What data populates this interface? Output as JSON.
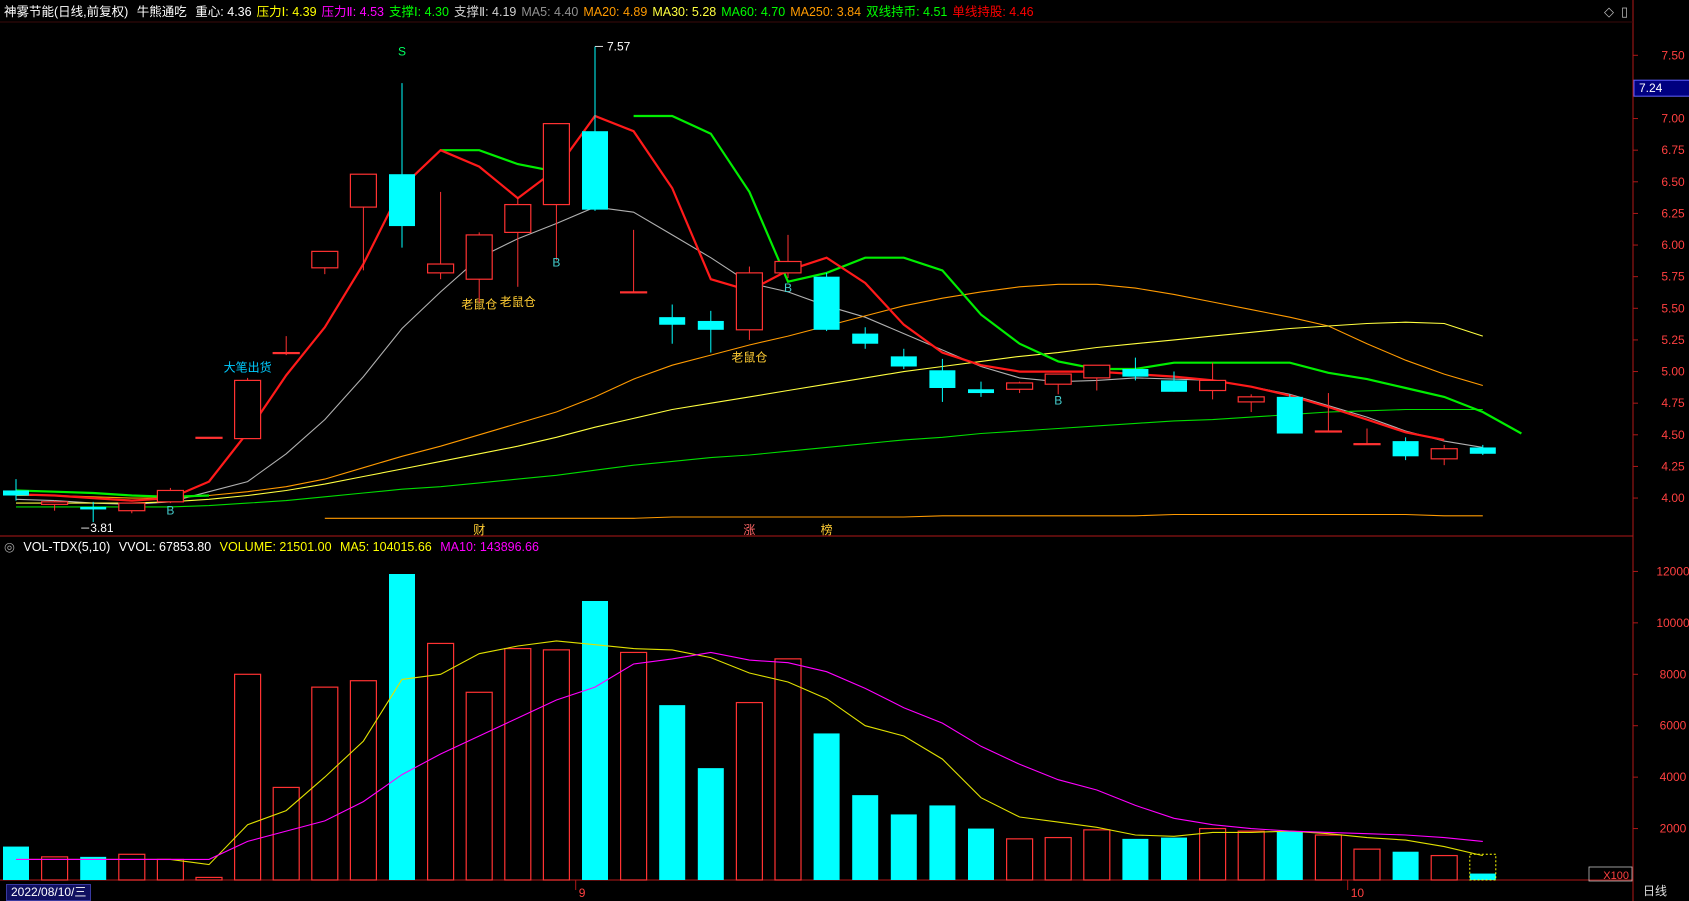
{
  "header": {
    "title": "神雾节能(日线,前复权)",
    "indicator": "牛熊通吃",
    "items": [
      {
        "label": "重心: 4.36",
        "color": "#ffffff"
      },
      {
        "label": "压力Ⅰ: 4.39",
        "color": "#ffff00"
      },
      {
        "label": "压力Ⅱ: 4.53",
        "color": "#ff00ff"
      },
      {
        "label": "支撑Ⅰ: 4.30",
        "color": "#00ff00"
      },
      {
        "label": "支撑Ⅱ: 4.19",
        "color": "#cfcfcf"
      },
      {
        "label": "MA5: 4.40",
        "color": "#909090"
      },
      {
        "label": "MA20: 4.89",
        "color": "#ff9a00"
      },
      {
        "label": "MA30: 5.28",
        "color": "#ffff40"
      },
      {
        "label": "MA60: 4.70",
        "color": "#00ff00"
      },
      {
        "label": "MA250: 3.84",
        "color": "#ff9a00"
      },
      {
        "label": "双线持币: 4.51",
        "color": "#00ff00"
      },
      {
        "label": "单线持股: 4.46",
        "color": "#ff0000"
      }
    ]
  },
  "volume_header": {
    "title": "VOL-TDX(5,10)",
    "vvol": "VVOL: 67853.80",
    "volume": "VOLUME: 21501.00",
    "ma5": "MA5: 104015.66",
    "ma10": "MA10: 143896.66"
  },
  "footer": {
    "date": "2022/08/10/三",
    "period": "日线",
    "unit": "X100"
  },
  "colors": {
    "up": "#ff3232",
    "down": "#00ffff",
    "bg": "#000000",
    "axis": "#b01818"
  },
  "chart_data": [
    {
      "type": "candlestick",
      "title": "神雾节能(日线,前复权)",
      "ylim": [
        3.7,
        7.7
      ],
      "y_ticks": [
        "4.00",
        "4.25",
        "4.50",
        "4.75",
        "5.00",
        "5.25",
        "5.50",
        "5.75",
        "6.00",
        "6.25",
        "6.50",
        "6.75",
        "7.00",
        "7.25",
        "7.50"
      ],
      "last_price": "7.24",
      "month_labels": [
        "9",
        "10"
      ],
      "bars": [
        {
          "o": 4.06,
          "h": 4.15,
          "l": 3.98,
          "c": 4.02
        },
        {
          "o": 3.95,
          "h": 3.98,
          "l": 3.9,
          "c": 3.97
        },
        {
          "o": 3.93,
          "h": 3.97,
          "l": 3.81,
          "c": 3.91
        },
        {
          "o": 3.9,
          "h": 3.95,
          "l": 3.88,
          "c": 3.96
        },
        {
          "o": 3.97,
          "h": 4.08,
          "l": 3.96,
          "c": 4.06
        },
        {
          "o": 4.48,
          "h": 4.48,
          "l": 4.48,
          "c": 4.48
        },
        {
          "o": 4.47,
          "h": 4.95,
          "l": 4.47,
          "c": 4.93
        },
        {
          "o": 5.15,
          "h": 5.28,
          "l": 5.13,
          "c": 5.15
        },
        {
          "o": 5.82,
          "h": 5.95,
          "l": 5.77,
          "c": 5.95
        },
        {
          "o": 6.3,
          "h": 6.56,
          "l": 5.8,
          "c": 6.56
        },
        {
          "o": 6.56,
          "h": 7.28,
          "l": 5.98,
          "c": 6.15
        },
        {
          "o": 5.78,
          "h": 6.42,
          "l": 5.73,
          "c": 5.85
        },
        {
          "o": 5.73,
          "h": 6.1,
          "l": 5.54,
          "c": 6.08
        },
        {
          "o": 6.1,
          "h": 6.38,
          "l": 5.67,
          "c": 6.32
        },
        {
          "o": 6.32,
          "h": 6.52,
          "l": 5.88,
          "c": 6.96
        },
        {
          "o": 6.9,
          "h": 7.57,
          "l": 6.27,
          "c": 6.28
        },
        {
          "o": 5.63,
          "h": 6.12,
          "l": 5.63,
          "c": 5.63
        },
        {
          "o": 5.43,
          "h": 5.53,
          "l": 5.22,
          "c": 5.37
        },
        {
          "o": 5.4,
          "h": 5.48,
          "l": 5.15,
          "c": 5.33
        },
        {
          "o": 5.33,
          "h": 5.83,
          "l": 5.25,
          "c": 5.78
        },
        {
          "o": 5.78,
          "h": 6.08,
          "l": 5.74,
          "c": 5.87
        },
        {
          "o": 5.75,
          "h": 5.78,
          "l": 5.32,
          "c": 5.33
        },
        {
          "o": 5.3,
          "h": 5.35,
          "l": 5.18,
          "c": 5.22
        },
        {
          "o": 5.12,
          "h": 5.18,
          "l": 5.02,
          "c": 5.04
        },
        {
          "o": 5.01,
          "h": 5.1,
          "l": 4.76,
          "c": 4.87
        },
        {
          "o": 4.86,
          "h": 4.92,
          "l": 4.8,
          "c": 4.83
        },
        {
          "o": 4.86,
          "h": 4.92,
          "l": 4.83,
          "c": 4.91
        },
        {
          "o": 4.9,
          "h": 4.98,
          "l": 4.82,
          "c": 4.98
        },
        {
          "o": 4.95,
          "h": 5.05,
          "l": 4.85,
          "c": 5.05
        },
        {
          "o": 5.02,
          "h": 5.11,
          "l": 4.93,
          "c": 4.96
        },
        {
          "o": 4.93,
          "h": 5.0,
          "l": 4.84,
          "c": 4.84
        },
        {
          "o": 4.85,
          "h": 5.07,
          "l": 4.78,
          "c": 4.93
        },
        {
          "o": 4.76,
          "h": 4.82,
          "l": 4.68,
          "c": 4.8
        },
        {
          "o": 4.8,
          "h": 4.82,
          "l": 4.51,
          "c": 4.51
        },
        {
          "o": 4.53,
          "h": 4.83,
          "l": 4.53,
          "c": 4.53
        },
        {
          "o": 4.43,
          "h": 4.55,
          "l": 4.43,
          "c": 4.43
        },
        {
          "o": 4.45,
          "h": 4.48,
          "l": 4.3,
          "c": 4.33
        },
        {
          "o": 4.31,
          "h": 4.42,
          "l": 4.26,
          "c": 4.39
        },
        {
          "o": 4.4,
          "h": 4.42,
          "l": 4.34,
          "c": 4.35
        }
      ],
      "series": [
        {
          "name": "MA5",
          "color": "#b0b0b0",
          "values": [
            3.99,
            3.98,
            3.96,
            3.95,
            3.97,
            4.05,
            4.13,
            4.35,
            4.62,
            4.96,
            5.34,
            5.63,
            5.9,
            6.05,
            6.17,
            6.3,
            6.26,
            6.08,
            5.9,
            5.7,
            5.63,
            5.52,
            5.43,
            5.3,
            5.17,
            5.04,
            4.95,
            4.92,
            4.93,
            4.95,
            4.94,
            4.93,
            4.88,
            4.82,
            4.73,
            4.64,
            4.53,
            4.45,
            4.4
          ]
        },
        {
          "name": "MA20",
          "color": "#ff9a00",
          "values": [
            4.02,
            4.02,
            4.01,
            4.0,
            4.0,
            4.02,
            4.05,
            4.09,
            4.15,
            4.24,
            4.33,
            4.41,
            4.5,
            4.59,
            4.68,
            4.8,
            4.94,
            5.05,
            5.13,
            5.21,
            5.28,
            5.36,
            5.44,
            5.52,
            5.58,
            5.63,
            5.67,
            5.69,
            5.69,
            5.66,
            5.61,
            5.55,
            5.49,
            5.43,
            5.36,
            5.22,
            5.09,
            4.98,
            4.89
          ]
        },
        {
          "name": "MA30",
          "color": "#ffff40",
          "values": [
            3.96,
            3.96,
            3.96,
            3.96,
            3.97,
            3.99,
            4.02,
            4.06,
            4.11,
            4.17,
            4.23,
            4.29,
            4.35,
            4.41,
            4.48,
            4.56,
            4.63,
            4.7,
            4.75,
            4.8,
            4.85,
            4.9,
            4.95,
            5.0,
            5.04,
            5.08,
            5.12,
            5.15,
            5.19,
            5.22,
            5.25,
            5.28,
            5.31,
            5.34,
            5.36,
            5.38,
            5.39,
            5.38,
            5.28
          ]
        },
        {
          "name": "MA60",
          "color": "#00dd00",
          "values": [
            3.93,
            3.93,
            3.93,
            3.93,
            3.93,
            3.94,
            3.96,
            3.98,
            4.01,
            4.04,
            4.07,
            4.09,
            4.12,
            4.15,
            4.18,
            4.22,
            4.26,
            4.29,
            4.32,
            4.34,
            4.37,
            4.4,
            4.43,
            4.46,
            4.48,
            4.51,
            4.53,
            4.55,
            4.57,
            4.59,
            4.61,
            4.62,
            4.64,
            4.66,
            4.68,
            4.69,
            4.7,
            4.7,
            4.7
          ]
        },
        {
          "name": "MA250",
          "color": "#ff9a00",
          "x_from": 8,
          "values": [
            3.84,
            3.84,
            3.84,
            3.84,
            3.84,
            3.84,
            3.84,
            3.84,
            3.84,
            3.85,
            3.85,
            3.85,
            3.85,
            3.85,
            3.85,
            3.85,
            3.86,
            3.86,
            3.86,
            3.86,
            3.86,
            3.86,
            3.87,
            3.87,
            3.87,
            3.87,
            3.87,
            3.87,
            3.87,
            3.86,
            3.86
          ]
        },
        {
          "name": "双线持币",
          "color": "#00ee00",
          "segments": [
            {
              "from": 0,
              "values": [
                4.06,
                4.05,
                4.04,
                4.02,
                4.01,
                4.02
              ]
            },
            {
              "from": 11,
              "values": [
                6.75,
                6.75,
                6.64,
                6.58
              ]
            },
            {
              "from": 16,
              "values": [
                7.02,
                7.02,
                6.88,
                6.42,
                5.71,
                5.78,
                5.9,
                5.9,
                5.8,
                5.45,
                5.22,
                5.08,
                5.02,
                5.02,
                5.07,
                5.07,
                5.07,
                5.07,
                4.99,
                4.94,
                4.87,
                4.8,
                4.68,
                4.51
              ]
            }
          ]
        },
        {
          "name": "单线持股",
          "color": "#ff1a1a",
          "values": [
            4.03,
            4.02,
            4.0,
            3.98,
            4.0,
            4.13,
            4.52,
            4.97,
            5.35,
            5.85,
            6.46,
            6.75,
            6.62,
            6.37,
            6.6,
            7.02,
            6.9,
            6.45,
            5.73,
            5.64,
            5.8,
            5.9,
            5.7,
            5.37,
            5.15,
            5.05,
            5.0,
            5.0,
            5.0,
            4.98,
            4.96,
            4.93,
            4.88,
            4.81,
            4.72,
            4.62,
            4.52,
            4.46
          ]
        }
      ],
      "annotations": [
        {
          "text": "S",
          "bar": 10,
          "value": 7.5,
          "color": "#00ff60"
        },
        {
          "text": "7.57",
          "bar": 15,
          "value": 7.57,
          "color": "#ffffff"
        },
        {
          "text": "3.81",
          "bar": 2,
          "value": 3.81,
          "color": "#ffffff"
        },
        {
          "text": "大笔出货",
          "bar": 6,
          "value": 5.0,
          "color": "#00ccff"
        },
        {
          "text": "老鼠仓",
          "bar": 12,
          "value": 5.5,
          "color": "#ffcc33"
        },
        {
          "text": "老鼠仓",
          "bar": 13,
          "value": 5.52,
          "color": "#ffcc33"
        },
        {
          "text": "老鼠仓",
          "bar": 19,
          "value": 5.08,
          "color": "#ffcc33"
        },
        {
          "text": "B",
          "bar": 4,
          "value": 3.87,
          "color": "#44cccc"
        },
        {
          "text": "B",
          "bar": 14,
          "value": 5.83,
          "color": "#44cccc"
        },
        {
          "text": "B",
          "bar": 20,
          "value": 5.63,
          "color": "#44cccc"
        },
        {
          "text": "B",
          "bar": 27,
          "value": 4.74,
          "color": "#44cccc"
        }
      ],
      "markers": [
        {
          "text": "财",
          "bar": 12
        },
        {
          "text": "涨",
          "bar": 19
        },
        {
          "text": "榜",
          "bar": 21
        }
      ]
    },
    {
      "type": "bar",
      "title": "VOL-TDX(5,10)",
      "ylim": [
        0,
        12600
      ],
      "y_ticks": [
        "2000",
        "4000",
        "6000",
        "8000",
        "10000",
        "12000"
      ],
      "values": [
        1300,
        900,
        900,
        1000,
        800,
        100,
        8000,
        3600,
        7500,
        7750,
        11900,
        9200,
        7300,
        9000,
        8950,
        10850,
        8850,
        6800,
        4350,
        6900,
        8600,
        5700,
        3300,
        2550,
        2900,
        2000,
        1600,
        1650,
        1950,
        1600,
        1650,
        2000,
        1900,
        1900,
        1750,
        1200,
        1100,
        950,
        250
      ],
      "series": [
        {
          "name": "MA5",
          "color": "#e0e000",
          "values": [
            800,
            800,
            800,
            800,
            800,
            600,
            2150,
            2700,
            4000,
            5400,
            7800,
            8000,
            8800,
            9100,
            9300,
            9150,
            9000,
            8950,
            8650,
            8050,
            7700,
            7050,
            6000,
            5600,
            4700,
            3200,
            2450,
            2250,
            2050,
            1750,
            1700,
            1850,
            1850,
            1900,
            1800,
            1650,
            1550,
            1300,
            950
          ]
        },
        {
          "name": "MA10",
          "color": "#ff00ff",
          "values": [
            800,
            800,
            800,
            800,
            800,
            800,
            1500,
            1900,
            2300,
            3050,
            4100,
            4900,
            5600,
            6300,
            7000,
            7500,
            8400,
            8600,
            8850,
            8550,
            8450,
            8100,
            7450,
            6700,
            6100,
            5200,
            4500,
            3900,
            3500,
            2900,
            2400,
            2150,
            2000,
            1900,
            1850,
            1800,
            1750,
            1650,
            1500
          ]
        }
      ],
      "dotted_box": true
    }
  ]
}
